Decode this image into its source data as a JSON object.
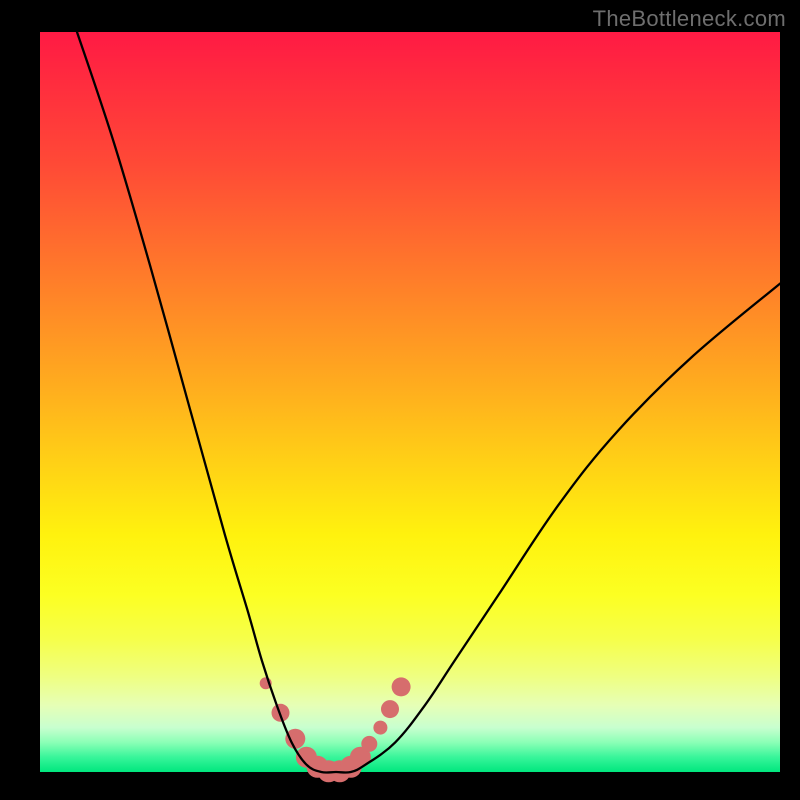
{
  "watermark": "TheBottleneck.com",
  "colors": {
    "background": "#000000",
    "curve": "#000000",
    "marker": "#d66d6d",
    "gradient_top": "#ff1a44",
    "gradient_bottom": "#00e77e"
  },
  "chart_data": {
    "type": "line",
    "title": "",
    "xlabel": "",
    "ylabel": "",
    "xlim": [
      0,
      100
    ],
    "ylim": [
      0,
      100
    ],
    "series": [
      {
        "name": "bottleneck_curve",
        "x": [
          5,
          10,
          15,
          20,
          25,
          28,
          30,
          32,
          34,
          36,
          38,
          40,
          42,
          44,
          48,
          52,
          56,
          62,
          70,
          78,
          88,
          100
        ],
        "y": [
          100,
          85,
          68,
          50,
          32,
          22,
          15,
          9,
          4,
          1,
          0,
          0,
          0,
          1,
          4,
          9,
          15,
          24,
          36,
          46,
          56,
          66
        ]
      }
    ],
    "markers": {
      "name": "highlight_points",
      "x": [
        30.5,
        32.5,
        34.5,
        36.0,
        37.5,
        39.0,
        40.5,
        42.0,
        43.3,
        44.5,
        46.0,
        47.3,
        48.8
      ],
      "y": [
        12.0,
        8.0,
        4.5,
        2.0,
        0.7,
        0.1,
        0.1,
        0.7,
        2.0,
        3.8,
        6.0,
        8.5,
        11.5
      ],
      "r": [
        6.0,
        9.0,
        10.0,
        10.5,
        11.0,
        11.0,
        11.0,
        11.0,
        10.5,
        8.0,
        7.0,
        9.0,
        9.5
      ]
    }
  }
}
